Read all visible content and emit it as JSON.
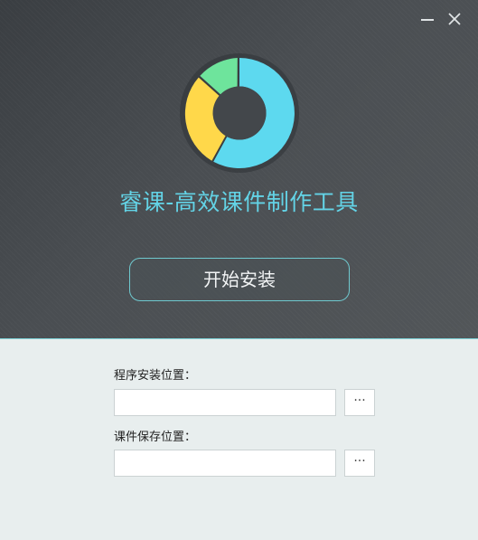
{
  "window": {
    "title": "睿课-高效课件制作工具"
  },
  "titlebar": {
    "minimize_icon": "minimize-icon",
    "close_icon": "close-icon"
  },
  "logo": {
    "colors": {
      "blue": "#5dd9ef",
      "yellow": "#ffd84a",
      "green": "#6ee49c",
      "ring_bg": "#3c4145"
    }
  },
  "main": {
    "install_button_label": "开始安装"
  },
  "settings": {
    "install_path_label": "程序安装位置：",
    "install_path_value": "",
    "install_path_browse": "···",
    "save_path_label": "课件保存位置：",
    "save_path_value": "",
    "save_path_browse": "···"
  },
  "theme": {
    "accent": "#63d3e6",
    "border_accent": "#6fc9cf",
    "dark_bg": "#46494d",
    "light_bg": "#e8eeee"
  }
}
